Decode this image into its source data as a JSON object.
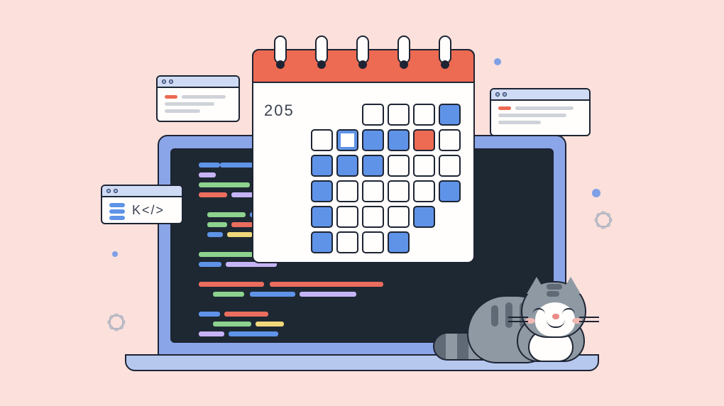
{
  "calendar": {
    "label": "205",
    "grid": [
      [
        "empty",
        "empty",
        "white",
        "white",
        "white",
        "blue"
      ],
      [
        "white",
        "ring",
        "blue",
        "blue",
        "orange",
        "white"
      ],
      [
        "blue",
        "blue",
        "blue",
        "white",
        "white",
        "white"
      ],
      [
        "blue",
        "white",
        "white",
        "white",
        "white",
        "blue"
      ],
      [
        "blue",
        "white",
        "white",
        "white",
        "blue",
        "empty"
      ],
      [
        "blue",
        "white",
        "white",
        "blue",
        "empty",
        "empty"
      ]
    ]
  },
  "code_window": {
    "text": "K</>"
  },
  "colors": {
    "background": "#fbe0dc",
    "accent_orange": "#ed6a53",
    "accent_blue": "#5f93e8",
    "laptop": "#8ba6e8",
    "screen": "#1e2833",
    "cat_gray": "#8e99a3"
  }
}
